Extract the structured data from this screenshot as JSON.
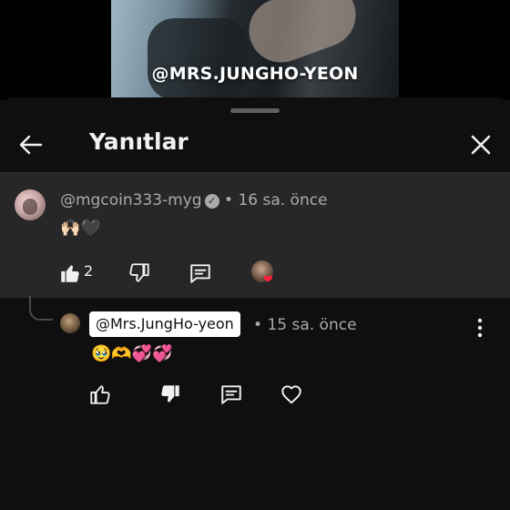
{
  "video": {
    "caption": "@MRS.JUNGHO-YEON"
  },
  "sheet": {
    "title": "Yanıtlar",
    "back_icon": "arrow-left-icon",
    "close_icon": "close-icon"
  },
  "parent_comment": {
    "handle": "@mgcoin333-myg",
    "verified_icon": "verified-check-icon",
    "separator": "•",
    "time": "16 sa. önce",
    "text": "🙌🏻🖤",
    "like_count": "2",
    "creator_heart": "❤"
  },
  "reply": {
    "mention": "@Mrs.JungHo-yeon",
    "separator": "•",
    "time": "15 sa. önce",
    "text": "🥹🫶💞💞",
    "more_icon": "more-vertical-icon"
  },
  "colors": {
    "background": "#0f0f0f",
    "highlight": "#272727",
    "secondary_text": "#aaaaaa",
    "heart": "#ff1f3d"
  }
}
